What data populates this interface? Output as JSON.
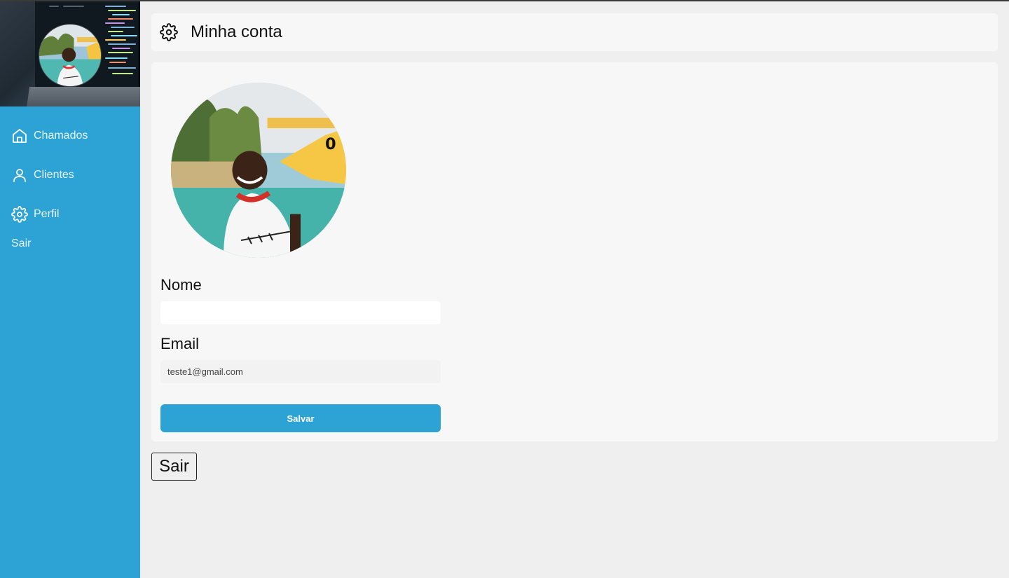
{
  "sidebar": {
    "banner_alt": "",
    "items": [
      {
        "label": "Chamados",
        "icon": "home-icon"
      },
      {
        "label": "Clientes",
        "icon": "user-icon"
      },
      {
        "label": "Perfil",
        "icon": "gear-icon"
      }
    ],
    "logout_label": "Sair"
  },
  "header": {
    "title": "Minha conta",
    "icon": "gear-icon"
  },
  "profile": {
    "name_label": "Nome",
    "name_value": "",
    "email_label": "Email",
    "email_value": "teste1@gmail.com",
    "save_label": "Salvar"
  },
  "logout_button_label": "Sair",
  "colors": {
    "accent": "#2da3d5",
    "background": "#efefef",
    "card": "#f7f7f7"
  }
}
